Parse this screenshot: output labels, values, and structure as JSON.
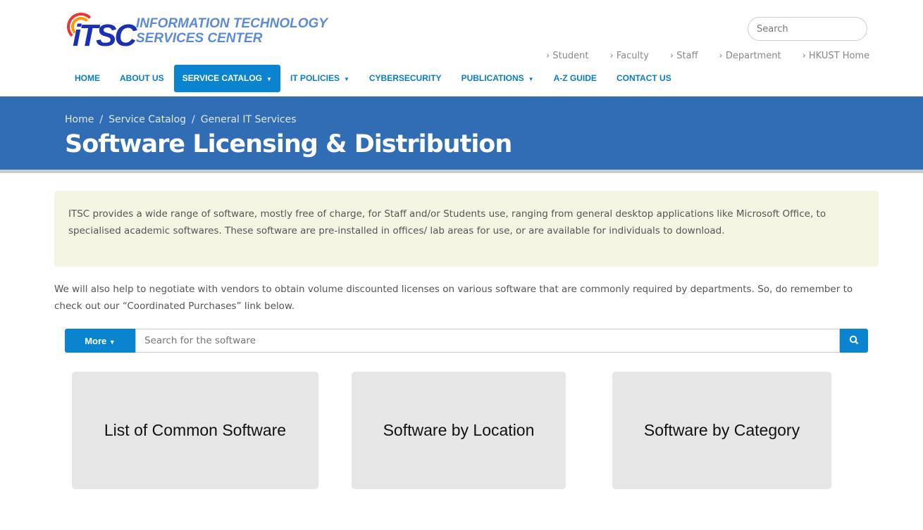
{
  "logo": {
    "mark": "iTSC",
    "line1": "INFORMATION TECHNOLOGY",
    "line2": "SERVICES CENTER"
  },
  "search_top": {
    "placeholder": "Search"
  },
  "quick_links": [
    "Student",
    "Faculty",
    "Staff",
    "Department",
    "HKUST Home"
  ],
  "nav": [
    "HOME",
    "ABOUT US",
    "SERVICE CATALOG",
    "IT POLICIES",
    "CYBERSECURITY",
    "PUBLICATIONS",
    "A-Z GUIDE",
    "CONTACT US"
  ],
  "breadcrumb": [
    "Home",
    "Service Catalog",
    "General IT Services"
  ],
  "page_title": "Software Licensing & Distribution",
  "intro": "ITSC provides a wide range of software, mostly free of charge, for Staff and/or Students use, ranging from general desktop applications like Microsoft Office, to specialised academic softwares. These software are pre-installed in offices/ lab areas for use, or are available for individuals to download.",
  "paragraph": "We will also help to negotiate with vendors to obtain volume discounted licenses on various software that are commonly required by departments. So, do remember to check out our “Coordinated Purchases” link below.",
  "software_search": {
    "more_label": "More",
    "placeholder": "Search for the software"
  },
  "cards": [
    "List of Common Software",
    "Software by Location",
    "Software by Category"
  ]
}
